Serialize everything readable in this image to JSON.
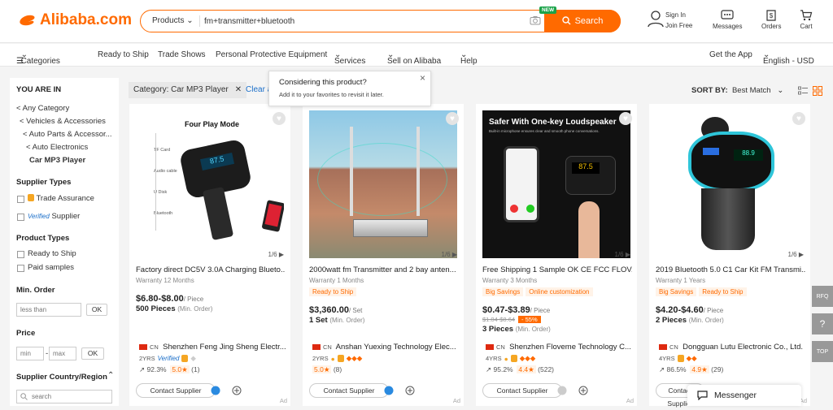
{
  "header": {
    "logo_text": "Alibaba.com",
    "search_category": "Products",
    "search_value": "fm+transmitter+bluetooth",
    "search_button": "Search",
    "new_badge": "NEW",
    "sign_in": "Sign In",
    "join_free": "Join Free",
    "messages": "Messages",
    "orders": "Orders",
    "cart": "Cart",
    "accent_color": "#ff6a00"
  },
  "nav": {
    "categories": "Categories",
    "items": [
      "Ready to Ship",
      "Trade Shows",
      "Personal Protective Equipment",
      "Services",
      "Sell on Alibaba",
      "Help"
    ],
    "get_app": "Get the App",
    "lang": "English - USD"
  },
  "sidebar": {
    "you_are_in": "YOU ARE IN",
    "crumbs": [
      "< Any Category",
      "< Vehicles & Accessories",
      "< Auto Parts & Accessor...",
      "< Auto Electronics",
      "Car MP3 Player"
    ],
    "supplier_types": "Supplier Types",
    "trade_assurance": "Trade Assurance",
    "verified": "Verified",
    "supplier": "Supplier",
    "product_types": "Product Types",
    "ready_to_ship": "Ready to Ship",
    "paid_samples": "Paid samples",
    "min_order": "Min. Order",
    "less_than": "less than",
    "ok": "OK",
    "price": "Price",
    "min": "min",
    "max": "max",
    "dash": "-",
    "country": "Supplier Country/Region",
    "search_placeholder": "search"
  },
  "filter": {
    "chip": "Category: Car MP3 Player",
    "clear": "Clear a"
  },
  "tooltip": {
    "title": "Considering this product?",
    "text": "Add it to your favorites to revisit it later."
  },
  "sort": {
    "label": "SORT BY:",
    "value": "Best Match"
  },
  "cards": [
    {
      "image_caption": "Four Play Mode",
      "image_labels": [
        "TF Card",
        "Audio cable",
        "U Disk",
        "Bluetooth"
      ],
      "pager": "1/6",
      "title": "Factory direct DC5V 3.0A Charging Blueto...",
      "warranty": "Warranty 12 Months",
      "tags": [],
      "price": "$6.80-$8.00",
      "unit": "/ Piece",
      "moq": "500 Pieces",
      "moq_note": "(Min. Order)",
      "supplier": "Shenzhen Feng Jing Sheng Electr...",
      "country": "CN",
      "years": "2YRS",
      "verified": "Verified",
      "response": "92.3%",
      "rating": "5.0",
      "reviews": "(1)",
      "contact": "Contact Supplier",
      "ad": "Ad"
    },
    {
      "pager": "1/6",
      "title": "2000watt fm Transmitter and 2 bay anten...",
      "warranty": "Warranty 1 Months",
      "tags": [
        "Ready to Ship"
      ],
      "price": "$3,360.00",
      "unit": "/ Set",
      "moq": "1 Set",
      "moq_note": "(Min. Order)",
      "supplier": "Anshan Yuexing Technology Elec...",
      "country": "CN",
      "years": "2YRS",
      "response": "",
      "rating": "5.0",
      "reviews": "(8)",
      "contact": "Contact Supplier",
      "ad": "Ad"
    },
    {
      "image_caption": "Safer With One-key Loudspeaker",
      "image_sub": "Built-in microphone ensures clear and smooth phone conversations.",
      "image_readout": "87.5",
      "pager": "1/6",
      "title": "Free Shipping 1 Sample OK CE FCC FLOV...",
      "warranty": "Warranty 3 Months",
      "tags": [
        "Big Savings",
        "Online customization"
      ],
      "price": "$0.47-$3.89",
      "unit": "/ Piece",
      "old_price": "$1.04-$8.64",
      "discount": "- 55%",
      "moq": "3 Pieces",
      "moq_note": "(Min. Order)",
      "supplier": "Shenzhen Floveme Technology C...",
      "country": "CN",
      "years": "4YRS",
      "response": "95.2%",
      "rating": "4.4",
      "reviews": "(522)",
      "contact": "Contact Supplier",
      "ad": "Ad"
    },
    {
      "pager": "1/6",
      "title": "2019 Bluetooth 5.0 C1 Car Kit FM Transmi...",
      "warranty": "Warranty 1 Years",
      "tags": [
        "Big Savings",
        "Ready to Ship"
      ],
      "price": "$4.20-$4.60",
      "unit": "/ Piece",
      "moq": "2 Pieces",
      "moq_note": "(Min. Order)",
      "supplier": "Dongguan Lutu Electronic Co., Ltd.",
      "country": "CN",
      "years": "4YRS",
      "response": "86.5%",
      "rating": "4.9",
      "reviews": "(29)",
      "contact": "Contact Supplier",
      "ad": "Ad"
    }
  ],
  "right_tools": [
    "RFQ",
    "?",
    "TOP"
  ],
  "messenger": "Messenger"
}
